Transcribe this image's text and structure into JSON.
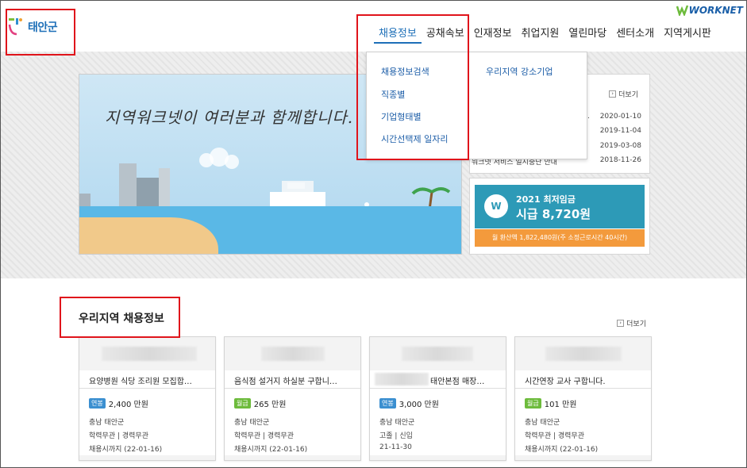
{
  "header": {
    "logo_text": "태안군",
    "worknet": "WORKNET",
    "nav": [
      "채용정보",
      "공채속보",
      "인재정보",
      "취업지원",
      "열린마당",
      "센터소개",
      "지역게시판"
    ]
  },
  "dropdown": {
    "col1": [
      "채용정보검색",
      "직종별",
      "기업형태별",
      "시간선택제 일자리"
    ],
    "col2": [
      "우리지역 강소기업"
    ]
  },
  "hero": {
    "text": "지역워크넷이 여러분과 함께합니다."
  },
  "notice": {
    "more": "더보기",
    "rows": [
      {
        "title": "...",
        "date": "2020-01-10"
      },
      {
        "title": "",
        "date": "2019-11-04"
      },
      {
        "title": "",
        "date": "2019-03-08"
      },
      {
        "title": "워크넷 서비스 일시중단 안내",
        "date": "2018-11-26"
      }
    ]
  },
  "wage": {
    "title": "2021 최저임금",
    "value": "시급 8,720원",
    "coin": "W",
    "foot": "월 환산액 1,822,480원(주 소정근로시간 40시간)"
  },
  "jobs": {
    "title": "우리지역 채용정보",
    "more": "더보기",
    "cards": [
      {
        "title": "요양병원 식당 조리원 모집합…",
        "pay_type": "연봉",
        "pay_color": "#3b8fd0",
        "pay": "2,400 만원",
        "region": "충남 태안군",
        "req": "학력무관 | 경력무관",
        "deadline": "채용시까지 (22-01-16)"
      },
      {
        "title": "음식점 설거지 하실분 구합니…",
        "pay_type": "월급",
        "pay_color": "#6dbb3c",
        "pay": "265 만원",
        "region": "충남 태안군",
        "req": "학력무관 | 경력무관",
        "deadline": "채용시까지 (22-01-16)"
      },
      {
        "title": "태안본점 매장…",
        "pay_type": "연봉",
        "pay_color": "#3b8fd0",
        "pay": "3,000 만원",
        "region": "충남 태안군",
        "req": "고졸 | 신입",
        "deadline": "21-11-30"
      },
      {
        "title": "시간연장 교사 구합니다.",
        "pay_type": "월급",
        "pay_color": "#6dbb3c",
        "pay": "101 만원",
        "region": "충남 태안군",
        "req": "학력무관 | 경력무관",
        "deadline": "채용시까지 (22-01-16)"
      }
    ]
  }
}
